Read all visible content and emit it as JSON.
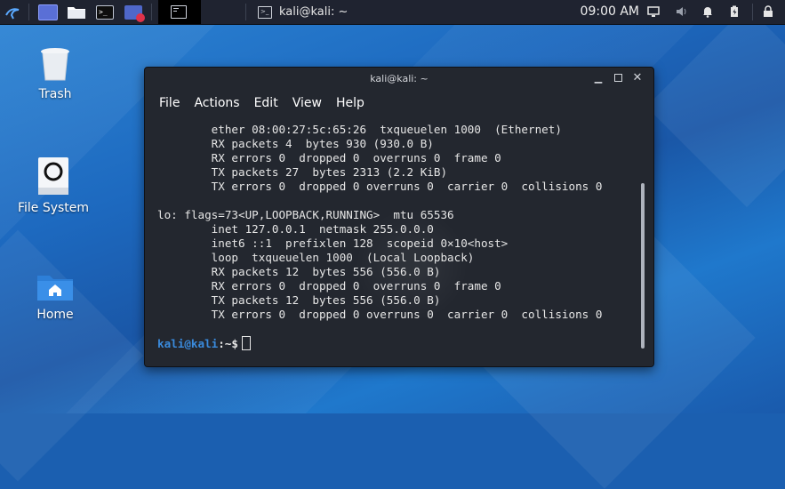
{
  "panel": {
    "window_task_title": "kali@kali: ~",
    "clock": "09:00 AM"
  },
  "desktop": {
    "icons": [
      {
        "label": "Trash"
      },
      {
        "label": "File System"
      },
      {
        "label": "Home"
      }
    ]
  },
  "terminal": {
    "title": "kali@kali: ~",
    "menu": [
      "File",
      "Actions",
      "Edit",
      "View",
      "Help"
    ],
    "lines": [
      "        ether 08:00:27:5c:65:26  txqueuelen 1000  (Ethernet)",
      "        RX packets 4  bytes 930 (930.0 B)",
      "        RX errors 0  dropped 0  overruns 0  frame 0",
      "        TX packets 27  bytes 2313 (2.2 KiB)",
      "        TX errors 0  dropped 0 overruns 0  carrier 0  collisions 0",
      "",
      "lo: flags=73<UP,LOOPBACK,RUNNING>  mtu 65536",
      "        inet 127.0.0.1  netmask 255.0.0.0",
      "        inet6 ::1  prefixlen 128  scopeid 0×10<host>",
      "        loop  txqueuelen 1000  (Local Loopback)",
      "        RX packets 12  bytes 556 (556.0 B)",
      "        RX errors 0  dropped 0  overruns 0  frame 0",
      "        TX packets 12  bytes 556 (556.0 B)",
      "        TX errors 0  dropped 0 overruns 0  carrier 0  collisions 0"
    ],
    "prompt_user": "kali@kali",
    "prompt_path": ":~$"
  }
}
